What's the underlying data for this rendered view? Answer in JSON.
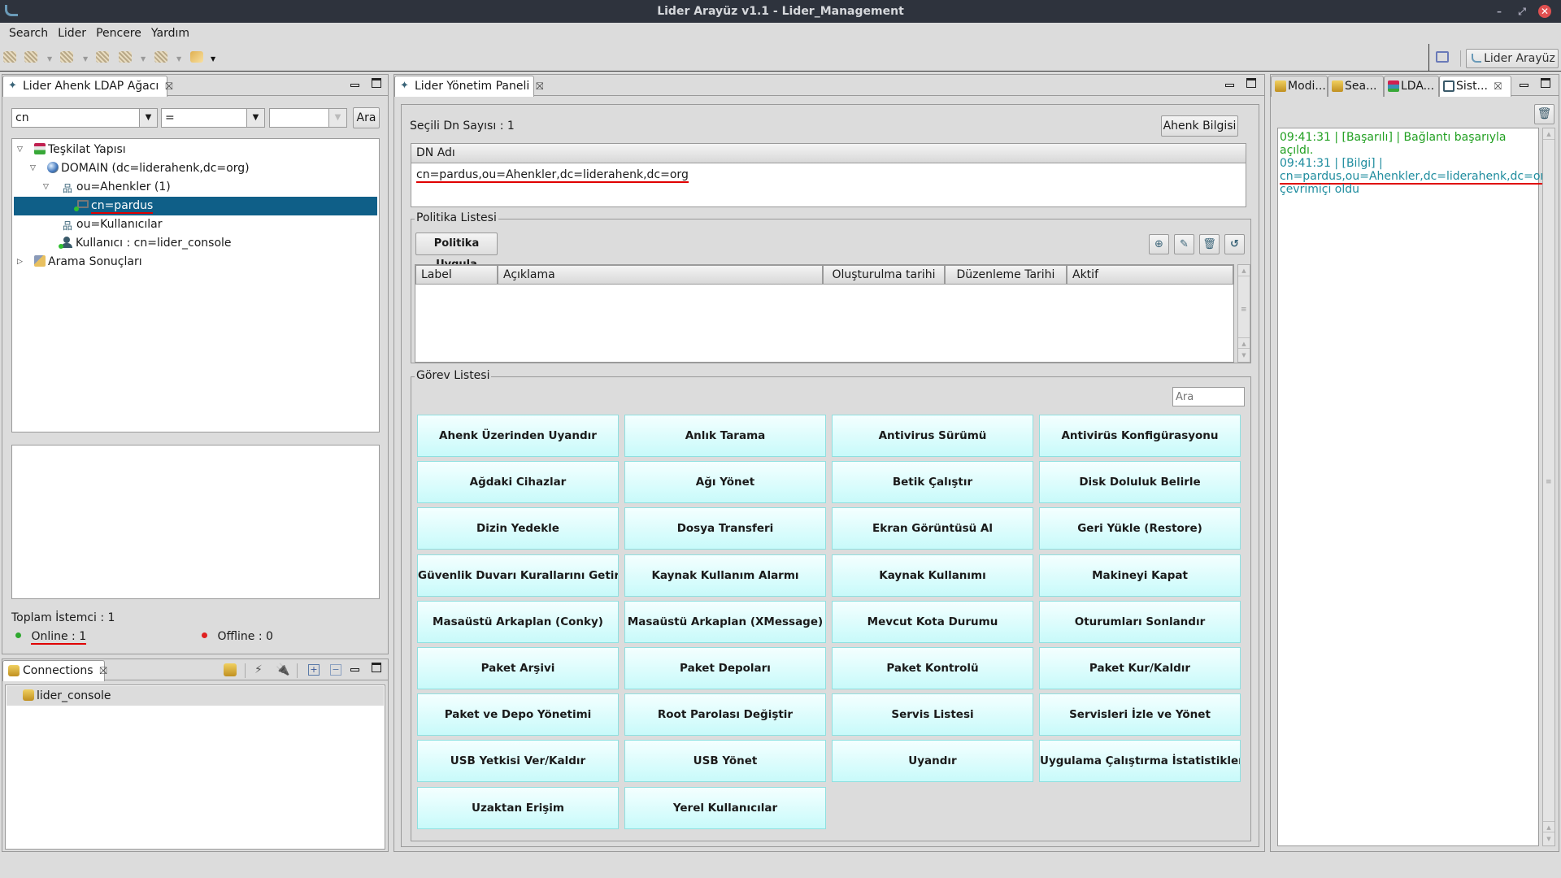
{
  "window": {
    "title": "Lider Arayüz v1.1 - Lider_Management",
    "controls": [
      "minimize",
      "maximize",
      "close"
    ]
  },
  "menu": [
    "Search",
    "Lider",
    "Pencere",
    "Yardım"
  ],
  "perspective": {
    "label": "Lider Arayüz"
  },
  "ldap_tree_view": {
    "tab_label": "Lider Ahenk LDAP Ağacı",
    "search": {
      "attribute": "cn",
      "operator": "=",
      "value": "",
      "button": "Ara"
    },
    "tree": [
      {
        "label": "Teşkilat Yapısı",
        "level": 0,
        "expanded": true,
        "icon": "org-structure-icon"
      },
      {
        "label": "DOMAIN (dc=liderahenk,dc=org)",
        "level": 1,
        "expanded": true,
        "icon": "globe-icon"
      },
      {
        "label": "ou=Ahenkler (1)",
        "level": 2,
        "expanded": true,
        "icon": "org-unit-icon"
      },
      {
        "label": "cn=pardus",
        "level": 3,
        "selected": true,
        "icon": "computer-online-icon"
      },
      {
        "label": "ou=Kullanıcılar",
        "level": 2,
        "icon": "org-unit-icon"
      },
      {
        "label": "Kullanıcı : cn=lider_console",
        "level": 2,
        "icon": "user-online-icon"
      },
      {
        "label": "Arama Sonuçları",
        "level": 0,
        "expanded": false,
        "icon": "search-results-icon"
      }
    ],
    "total_clients": "Toplam İstemci : 1",
    "online": "Online : 1",
    "offline": "Offline : 0",
    "online_color": "#2ea82e",
    "offline_color": "#e02020"
  },
  "connections_view": {
    "tab_label": "Connections",
    "items": [
      "lider_console"
    ]
  },
  "management_panel": {
    "tab_label": "Lider Yönetim Paneli",
    "selected_dn_count": "Seçili Dn Sayısı : 1",
    "ahenk_info_button": "Ahenk Bilgisi",
    "dn_table": {
      "header": "DN Adı",
      "rows": [
        "cn=pardus,ou=Ahenkler,dc=liderahenk,dc=org"
      ]
    },
    "policy_section": {
      "title": "Politika Listesi",
      "apply_button": "Politika Uygula",
      "columns": [
        "Label",
        "Açıklama",
        "Oluşturulma tarihi",
        "Düzenleme Tarihi",
        "Aktif"
      ],
      "rows": []
    },
    "task_section": {
      "title": "Görev Listesi",
      "search_placeholder": "Ara",
      "tasks": [
        "Ahenk Üzerinden Uyandır",
        "Anlık Tarama",
        "Antivirus Sürümü",
        "Antivirüs Konfigürasyonu",
        "Ağdaki Cihazlar",
        "Ağı Yönet",
        "Betik Çalıştır",
        "Disk Doluluk Belirle",
        "Dizin Yedekle",
        "Dosya Transferi",
        "Ekran Görüntüsü Al",
        "Geri Yükle (Restore)",
        "Güvenlik Duvarı Kurallarını Getir",
        "Kaynak Kullanım Alarmı",
        "Kaynak Kullanımı",
        "Makineyi Kapat",
        "Masaüstü Arkaplan (Conky)",
        "Masaüstü Arkaplan (XMessage)",
        "Mevcut Kota Durumu",
        "Oturumları Sonlandır",
        "Paket Arşivi",
        "Paket Depoları",
        "Paket Kontrolü",
        "Paket Kur/Kaldır",
        "Paket ve Depo Yönetimi",
        "Root Parolası Değiştir",
        "Servis Listesi",
        "Servisleri İzle ve Yönet",
        "USB Yetkisi Ver/Kaldır",
        "USB Yönet",
        "Uyandır",
        "Uygulama Çalıştırma İstatistikleri",
        "Uzaktan Erişim",
        "Yerel Kullanıcılar"
      ]
    }
  },
  "right_tabs": [
    "Modi...",
    "Sea...",
    "LDA...",
    "Sist..."
  ],
  "system_log": {
    "entries": [
      {
        "type": "success",
        "text": "09:41:31  |  [Başarılı]  |  Bağlantı başarıyla açıldı."
      },
      {
        "type": "info",
        "text": "09:41:31  |  [Bilgi]  |"
      },
      {
        "type": "info",
        "text": "cn=pardus,ou=Ahenkler,dc=liderahenk,dc=org"
      },
      {
        "type": "info",
        "text": "çevrimiçi oldu"
      }
    ],
    "success_color": "#22a022",
    "info_color": "#1e8c9e"
  }
}
